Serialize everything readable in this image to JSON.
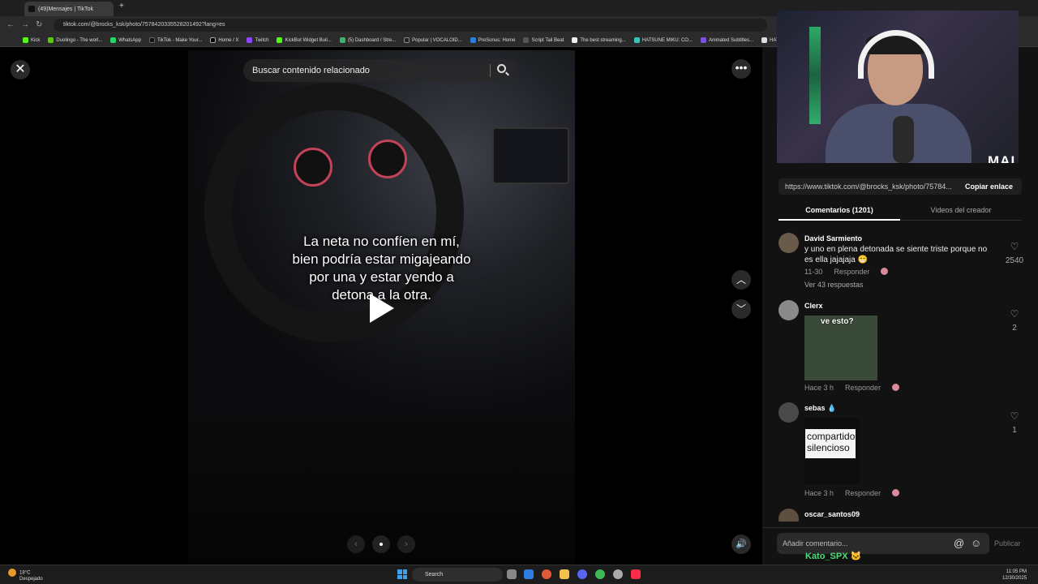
{
  "browser": {
    "tab_title": "(49)Mensajes | TikTok",
    "url": "tiktok.com/@brocks_ksk/photo/7578420335528201492?lang=es",
    "bookmarks": [
      "Kick",
      "Duolingo - The worl...",
      "WhatsApp",
      "TikTok - Make Your...",
      "Home / X",
      "Twitch",
      "KickBot Widget Buil...",
      "(5) Dashboard / Stre...",
      "Popular | VOCALOID...",
      "PreSonus: Home",
      "Script Tail Beat",
      "The best streaming...",
      "HATSUNE MIKU: CO...",
      "Animated Subtitles...",
      "HATSUN"
    ]
  },
  "viewer": {
    "search_placeholder": "Buscar contenido relacionado",
    "caption_lines": [
      "La neta no confíen en mí,",
      "bien podría estar migajeando",
      "por una y estar yendo a",
      "detona a la otra."
    ],
    "close_icon": "close-icon",
    "more_icon": "more-icon"
  },
  "overlay": {
    "stream_brand": "MAI"
  },
  "panel": {
    "share_url": "https://www.tiktok.com/@brocks_ksk/photo/75784...",
    "copy_label": "Copiar enlace",
    "tab_comments": "Comentarios (1201)",
    "tab_creator": "Videos del creador",
    "comments": [
      {
        "user": "David Sarmiento",
        "text": "y uno en plena detonada se siente triste porque no es ella jajajaja 😁",
        "time": "11-30",
        "reply": "Responder",
        "likes": "2540",
        "replies_label": "Ver 43 respuestas"
      },
      {
        "user": "Clerx",
        "text": "ve esto?",
        "time": "Hace 3 h",
        "reply": "Responder",
        "likes": "2"
      },
      {
        "user": "sebas 💧",
        "text": "compartido silencioso",
        "time": "Hace 3 h",
        "reply": "Responder",
        "likes": "1"
      },
      {
        "user": "oscar_santos09"
      }
    ],
    "comment_placeholder": "Añadir comentario...",
    "publish_label": "Publicar",
    "chat_overlay_name": "Kato_SPX 🐱"
  },
  "taskbar": {
    "temperature": "18°C",
    "weather": "Despejado",
    "search_label": "Search",
    "time": "11:05 PM",
    "date": "12/30/2025"
  }
}
